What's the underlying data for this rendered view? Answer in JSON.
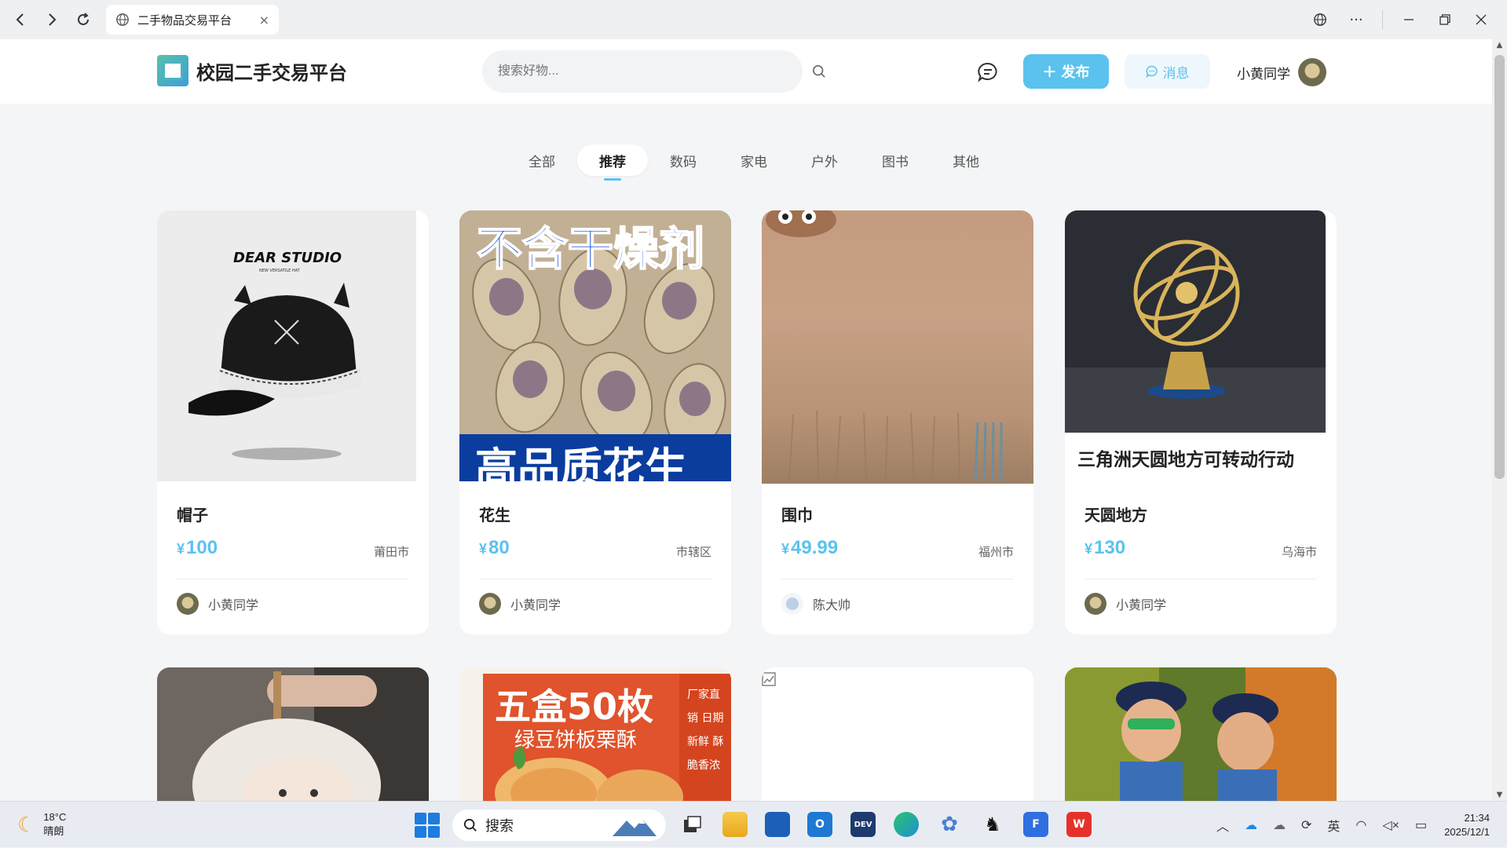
{
  "browser": {
    "tab_title": "二手物品交易平台",
    "tab_close": "×"
  },
  "header": {
    "logo_text": "校园二手交易平台",
    "search_placeholder": "搜索好物...",
    "publish_label": "发布",
    "publish_plus": "＋",
    "message_label": "消息",
    "username": "小黄同学"
  },
  "categories": [
    "全部",
    "推荐",
    "数码",
    "家电",
    "户外",
    "图书",
    "其他"
  ],
  "active_category": "推荐",
  "products": [
    {
      "title": "帽子",
      "currency": "¥",
      "price": "100",
      "location": "莆田市",
      "seller": "小黄同学",
      "image_caption": "DEAR STUDIO",
      "image_subcaption": "NEW VERSATILE HAT"
    },
    {
      "title": "花生",
      "currency": "¥",
      "price": "80",
      "location": "市辖区",
      "seller": "小黄同学",
      "image_caption": "不含干燥剂",
      "image_subcaption": "高品质花生"
    },
    {
      "title": "围巾",
      "currency": "¥",
      "price": "49.99",
      "location": "福州市",
      "seller": "陈大帅"
    },
    {
      "title": "天圆地方",
      "currency": "¥",
      "price": "130",
      "location": "乌海市",
      "seller": "小黄同学",
      "image_caption": "三角洲天圆地方可转动行动"
    }
  ],
  "products_row2": [
    {
      "image_caption": ""
    },
    {
      "image_caption": "五盒50枚",
      "image_subcaption": "绿豆饼板栗酥",
      "side_text": "厂家直销 日期新鲜 酥脆香浓"
    },
    {
      "image_caption": ""
    },
    {
      "image_caption": ""
    }
  ],
  "taskbar": {
    "temperature": "18°C",
    "weather": "晴朗",
    "search_label": "搜索",
    "ime": "英",
    "time": "21:34",
    "date": "2025/12/1",
    "app_dev": "DEV"
  },
  "colors": {
    "accent": "#5bc2ee",
    "background": "#f4f5f7"
  }
}
